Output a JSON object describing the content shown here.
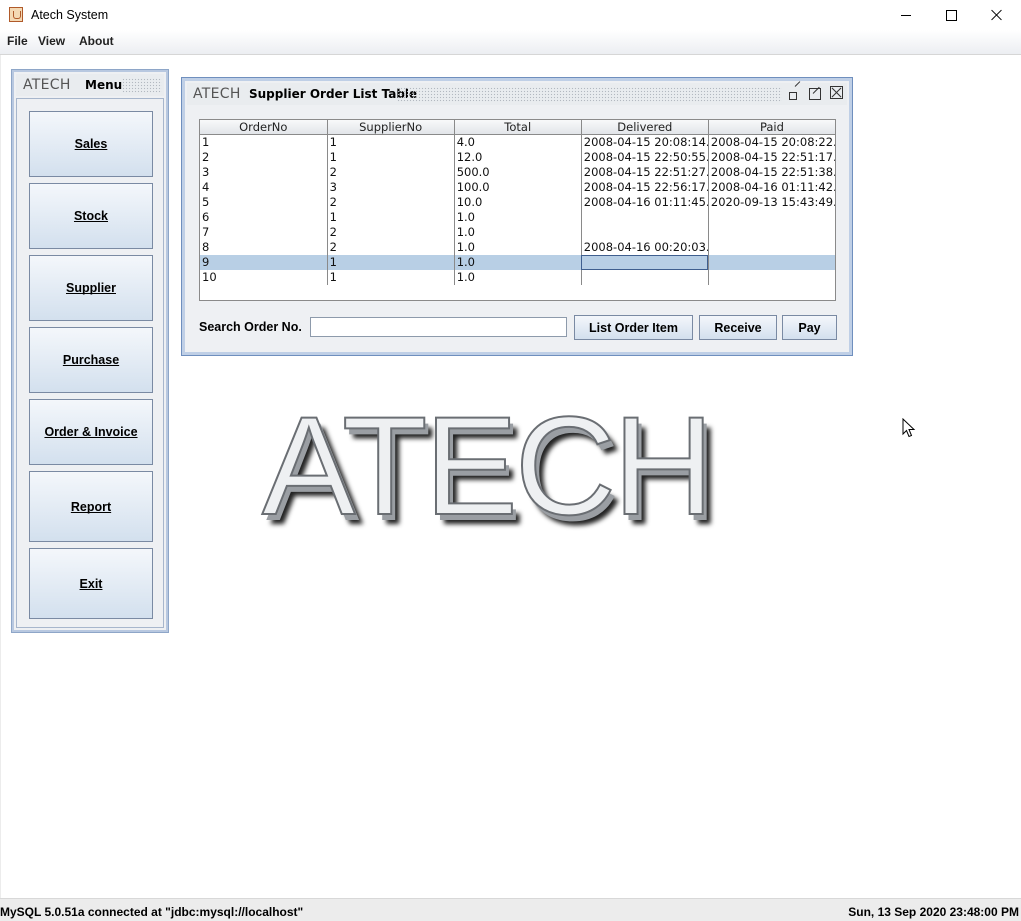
{
  "window": {
    "title": "Atech System"
  },
  "menubar": {
    "items": [
      "File",
      "View",
      "About"
    ]
  },
  "menu_frame": {
    "brand": "ATECH",
    "title": "Menu",
    "buttons": [
      "Sales",
      "Stock",
      "Supplier",
      "Purchase",
      "Order & Invoice",
      "Report",
      "Exit"
    ]
  },
  "order_frame": {
    "brand": "ATECH",
    "title": "Supplier Order List Table",
    "table": {
      "columns": [
        "OrderNo",
        "SupplierNo",
        "Total",
        "Delivered",
        "Paid"
      ],
      "rows": [
        [
          "1",
          "1",
          "4.0",
          "2008-04-15 20:08:14...",
          "2008-04-15 20:08:22..."
        ],
        [
          "2",
          "1",
          "12.0",
          "2008-04-15 22:50:55...",
          "2008-04-15 22:51:17..."
        ],
        [
          "3",
          "2",
          "500.0",
          "2008-04-15 22:51:27...",
          "2008-04-15 22:51:38..."
        ],
        [
          "4",
          "3",
          "100.0",
          "2008-04-15 22:56:17...",
          "2008-04-16 01:11:42..."
        ],
        [
          "5",
          "2",
          "10.0",
          "2008-04-16 01:11:45...",
          "2020-09-13 15:43:49..."
        ],
        [
          "6",
          "1",
          "1.0",
          "",
          ""
        ],
        [
          "7",
          "2",
          "1.0",
          "",
          ""
        ],
        [
          "8",
          "2",
          "1.0",
          "2008-04-16 00:20:03...",
          ""
        ],
        [
          "9",
          "1",
          "1.0",
          "",
          ""
        ],
        [
          "10",
          "1",
          "1.0",
          "",
          ""
        ]
      ]
    },
    "search_label": "Search Order No.",
    "search_value": "",
    "buttons": {
      "list_order_item": "List Order Item",
      "receive": "Receive",
      "pay": "Pay"
    }
  },
  "logo_text": "ATECH",
  "statusbar": {
    "left": "MySQL 5.0.51a connected at \"jdbc:mysql://localhost\"",
    "right": "Sun, 13 Sep 2020 23:48:00 PM"
  }
}
